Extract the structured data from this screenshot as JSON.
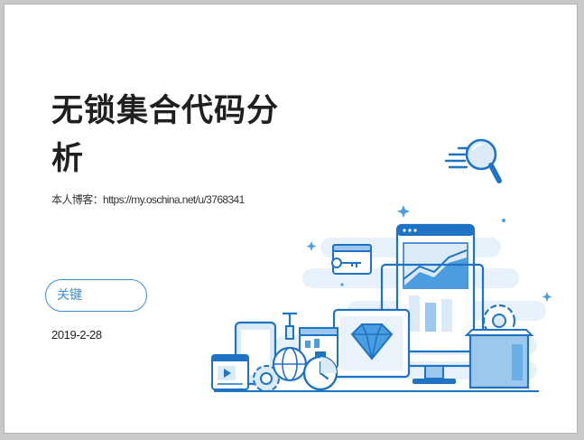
{
  "slide": {
    "title": "无锁集合代码分析",
    "blog": "本人博客：https://my.oschina.net/u/3768341",
    "keyword_label": "关键",
    "date": "2019-2-28"
  },
  "colors": {
    "accent": "#3a8ed6",
    "illustration_light": "#dbeaf7",
    "illustration_mid": "#9cc8ee",
    "illustration_dark": "#1f73c4"
  },
  "illustration": {
    "icons": [
      "magnifier-icon",
      "key-window-icon",
      "browser-chart-icon",
      "diamond-monitor-icon",
      "stopwatch-icon",
      "globe-flask-icon",
      "gear-icon",
      "video-player-icon",
      "box-icon"
    ]
  }
}
